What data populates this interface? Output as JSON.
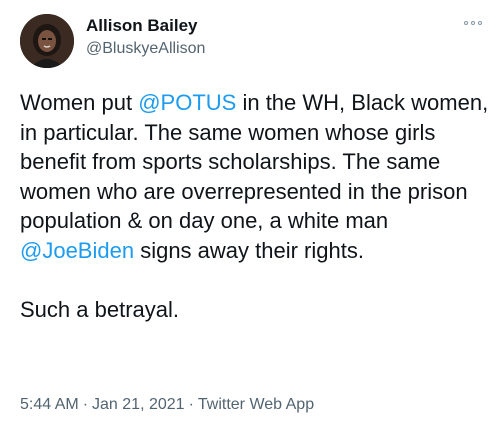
{
  "author": {
    "display_name": "Allison Bailey",
    "handle": "@BluskyeAllison"
  },
  "tweet": {
    "segments_line1": [
      "Women put ",
      "@POTUS",
      " in the WH, Black women, in particular. The same women whose girls benefit from sports scholarships. The same women who are overrepresented in the prison population & on day one, a white man ",
      "@JoeBiden",
      " signs away their rights."
    ],
    "closing": "Such a betrayal."
  },
  "meta": {
    "time": "5:44 AM",
    "date": "Jan 21, 2021",
    "separator": "·",
    "source": "Twitter Web App"
  },
  "colors": {
    "link": "#1d9bf0",
    "text": "#0f1419",
    "secondary": "#536471"
  },
  "icons": {
    "more": "more-options-icon"
  }
}
